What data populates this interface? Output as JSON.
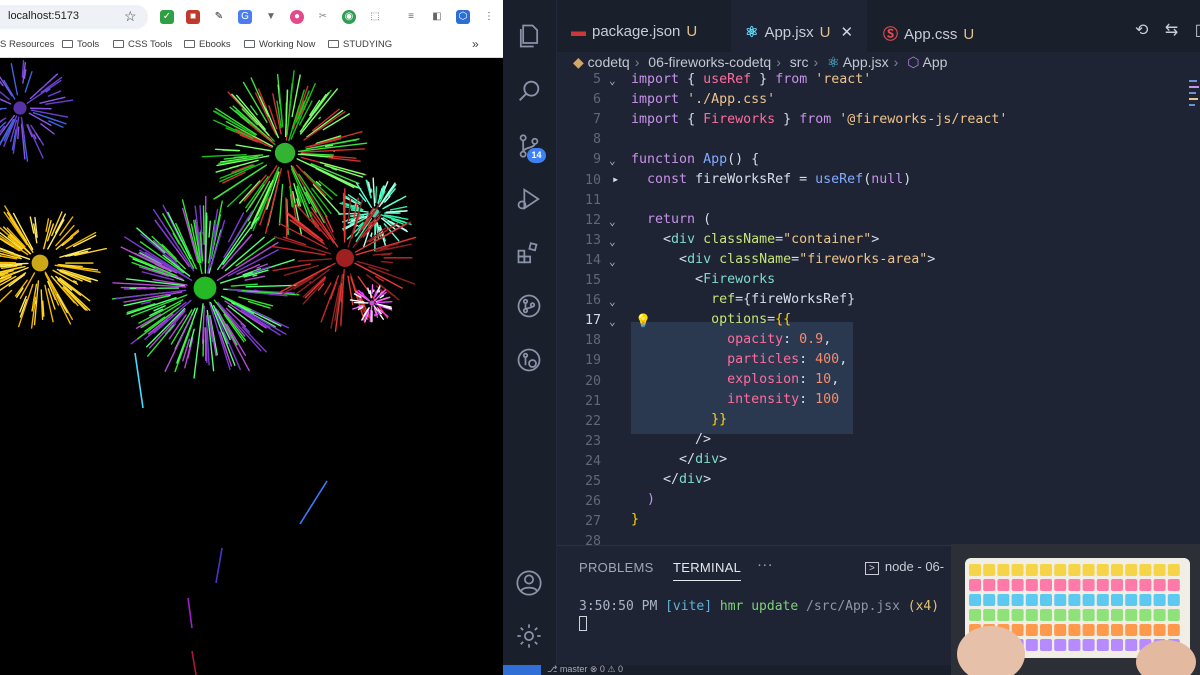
{
  "browser": {
    "url": "localhost:5173",
    "bookmarks": [
      "S Resources",
      "Tools",
      "CSS Tools",
      "Ebooks",
      "Working Now",
      "STUDYING"
    ],
    "more_symbol": "»"
  },
  "vscode": {
    "tabs": [
      {
        "label": "package.json",
        "status": "U",
        "icon": "npm-icon",
        "active": false
      },
      {
        "label": "App.jsx",
        "status": "U",
        "icon": "react-icon",
        "active": true
      },
      {
        "label": "App.css",
        "status": "U",
        "icon": "css-icon",
        "active": false
      }
    ],
    "breadcrumb": [
      "codetq",
      "06-fireworks-codetq",
      "src",
      "App.jsx",
      "App"
    ],
    "scm_badge": "14",
    "line_numbers": [
      "5",
      "6",
      "7",
      "8",
      "9",
      "10",
      "11",
      "12",
      "13",
      "14",
      "15",
      "16",
      "17",
      "18",
      "19",
      "20",
      "21",
      "22",
      "23",
      "24",
      "25",
      "26",
      "27",
      "28"
    ],
    "panel": {
      "tabs": [
        "PROBLEMS",
        "TERMINAL"
      ],
      "more": "···",
      "terminal_name": "node - 06-",
      "terminal_output": {
        "time": "3:50:50 PM",
        "tag": "[vite]",
        "msg": "hmr update",
        "path": "/src/App.jsx",
        "count": "(x4)"
      }
    },
    "status": {
      "text": "⎇ master   ⊗ 0 ⚠ 0"
    }
  },
  "colors": {
    "editor_bg": "#1e2433",
    "accent": "#3c82f6",
    "keyword": "#c792ea",
    "string": "#ecc48d"
  }
}
